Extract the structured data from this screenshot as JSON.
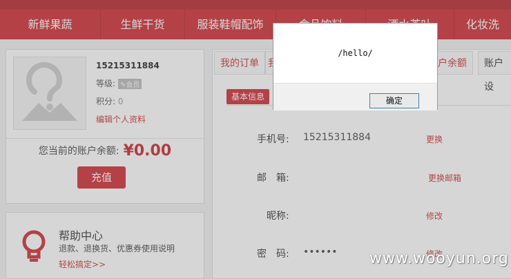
{
  "nav": {
    "items": [
      "新鲜果蔬",
      "生鲜干货",
      "服装鞋帽配饰",
      "食品饮料",
      "酒水茶叶",
      "化妆洗"
    ]
  },
  "profile": {
    "phone": "15215311884",
    "level_label": "等级:",
    "level_badge": "✎会员",
    "points_label": "积分:",
    "points_value": "0",
    "edit_link": "编辑个人资料",
    "balance_label": "您当前的账户余额:",
    "balance_amount": "¥0.00",
    "recharge_button": "充值"
  },
  "help": {
    "title": "帮助中心",
    "description": "退款、退换货、优惠券使用说明",
    "link": "轻松搞定>>"
  },
  "tabs": [
    "我的订单",
    "我",
    "户余额",
    "账户设"
  ],
  "section": {
    "title": "基本信息"
  },
  "rows": [
    {
      "label": "手机号:",
      "value": "15215311884",
      "action": "更换"
    },
    {
      "label": "邮　箱:",
      "value": "",
      "action": "更换邮箱"
    },
    {
      "label": "昵称:",
      "value": "",
      "action": "修改"
    },
    {
      "label": "密　码:",
      "value": "••••••",
      "action": "修改"
    }
  ],
  "dialog": {
    "message": "/hello/",
    "ok_button": "确定"
  },
  "watermark": "www.wooyun.org",
  "colors": {
    "brand_red": "#cf2a31",
    "link_red": "#cc3333"
  }
}
